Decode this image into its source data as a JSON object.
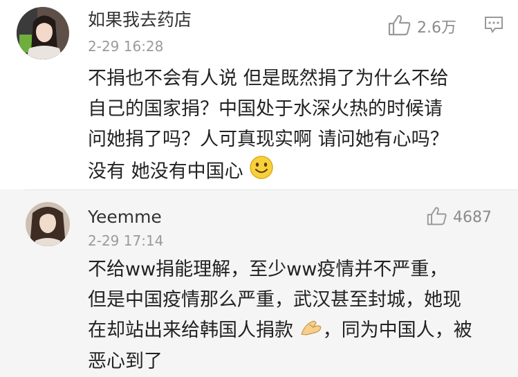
{
  "comments": [
    {
      "username": "如果我去药店",
      "timestamp": "2-29 16:28",
      "likes": "2.6万",
      "lines": [
        "不捐也不会有人说 但是既然捐了为什么不给",
        "自己的国家捐？中国处于水深火热的时候请",
        "问她捐了吗？人可真现实啊 请问她有心吗？",
        "没有 她没有中国心"
      ],
      "icons": {
        "like": "thumbs-up-icon",
        "reply": "comment-reply-icon",
        "emoji": "smiley-face-emoji"
      }
    },
    {
      "username": "Yeemme",
      "timestamp": "2-29 17:14",
      "likes": "4687",
      "lines": [
        "不给ww捐能理解，至少ww疫情并不严重，",
        "但是中国疫情那么严重，武汉甚至封城，她现",
        "在却站出来给韩国人捐款",
        "，同为中国人，被",
        "恶心到了"
      ],
      "icons": {
        "like": "thumbs-up-icon",
        "emoji": "folded-hands-emoji"
      }
    }
  ],
  "colors": {
    "text": "#222222",
    "username": "#333333",
    "meta": "#9a9a9a",
    "icon": "#999999",
    "top_bg": "#ffffff",
    "bottom_bg": "#f5f5f5"
  }
}
